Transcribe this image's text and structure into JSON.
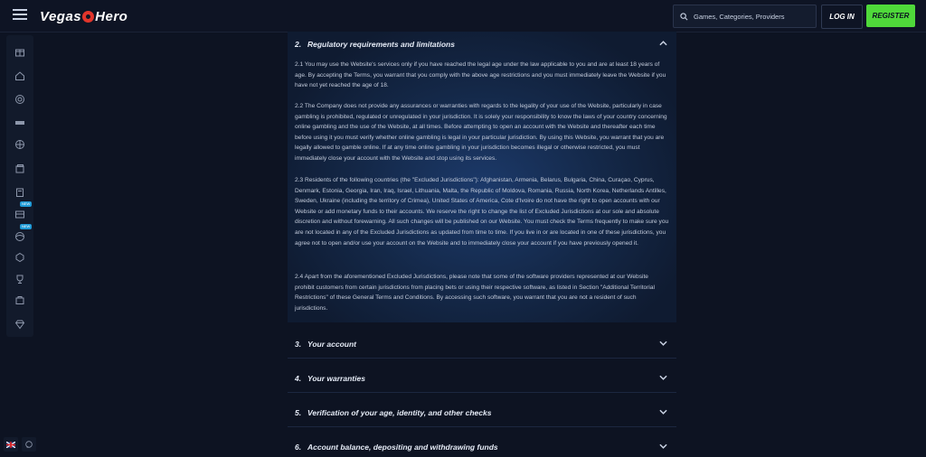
{
  "header": {
    "logo_part1": "Vegas",
    "logo_part2": "Hero",
    "search_placeholder": "Games, Categories, Providers",
    "login_label": "LOG IN",
    "register_label": "REGISTER"
  },
  "sidebar": {
    "items": [
      {
        "icon": "gift-icon"
      },
      {
        "icon": "home-icon"
      },
      {
        "icon": "casino-chip-icon"
      },
      {
        "icon": "slots-icon"
      },
      {
        "icon": "roulette-icon"
      },
      {
        "icon": "cards-icon"
      },
      {
        "icon": "live-casino-icon"
      },
      {
        "icon": "sportsbook-icon",
        "badge": "NEW"
      },
      {
        "icon": "ball-icon",
        "badge": "NEW"
      },
      {
        "icon": "vip-icon"
      },
      {
        "icon": "trophy-icon"
      },
      {
        "icon": "shop-icon"
      },
      {
        "icon": "diamond-icon"
      }
    ],
    "bottom": [
      {
        "icon": "uk-flag-icon"
      },
      {
        "icon": "chat-icon"
      }
    ]
  },
  "terms": {
    "open_section": {
      "number": "2.",
      "title": "Regulatory requirements and limitations",
      "paragraphs": [
        "2.1 You may use the Website's services only if you have reached the legal age under the law applicable to you and are at least 18 years of age. By accepting the Terms, you warrant that you comply with the above age restrictions and you must immediately leave the Website if you have not yet reached the age of 18.",
        "2.2 The Company does not provide any assurances or warranties with regards to the legality of your use of the Website, particularly in case gambling is prohibited, regulated or unregulated in your jurisdiction. It is solely your responsibility to know the laws of your country concerning online gambling and the use of the Website, at all times. Before attempting to open an account with the Website and thereafter each time before using it you must verify whether online gambling is legal in your particular jurisdiction. By using this Website, you warrant that you are legally allowed to gamble online. If at any time online gambling in your jurisdiction becomes illegal or otherwise restricted, you must immediately close your account with the Website and stop using its services.",
        "2.3 Residents of the following countries (the \"Excluded Jurisdictions\"): Afghanistan, Armenia, Belarus, Bulgaria, China, Curaçao, Cyprus, Denmark, Estonia, Georgia, Iran, Iraq, Israel, Lithuania, Malta, the Republic of Moldova, Romania, Russia, North Korea, Netherlands Antilles, Sweden, Ukraine (including the territory of Crimea), United States of America, Cote d'Ivoire do not have the right to open accounts with our Website or add monetary funds to their accounts. We reserve the right to change the list of Excluded Jurisdictions at our sole and absolute discretion and without forewarning. All such changes will be published on our Website. You must check the Terms frequently to make sure you are not located in any of the Excluded Jurisdictions as updated from time to time. If you live in or are located in one of these jurisdictions, you agree not to open and/or use your account on the Website and to immediately close your account if you have previously opened it.",
        "2.4 Apart from the aforementioned Excluded Jurisdictions, please note that some of the software providers represented at our Website prohibit customers from certain jurisdictions from placing bets or using their respective software, as listed in Section \"Additional Territorial Restrictions\" of these General Terms and Conditions. By accessing such software, you warrant that you are not a resident of such jurisdictions."
      ]
    },
    "collapsed_sections": [
      {
        "number": "3.",
        "title": "Your account"
      },
      {
        "number": "4.",
        "title": "Your warranties"
      },
      {
        "number": "5.",
        "title": "Verification of your age, identity, and other checks"
      },
      {
        "number": "6.",
        "title": "Account balance, depositing and withdrawing funds"
      }
    ]
  },
  "colors": {
    "background": "#0d1322",
    "accent_green": "#4fd93a",
    "logo_red": "#e2352b",
    "badge_blue": "#1e9ad6"
  }
}
